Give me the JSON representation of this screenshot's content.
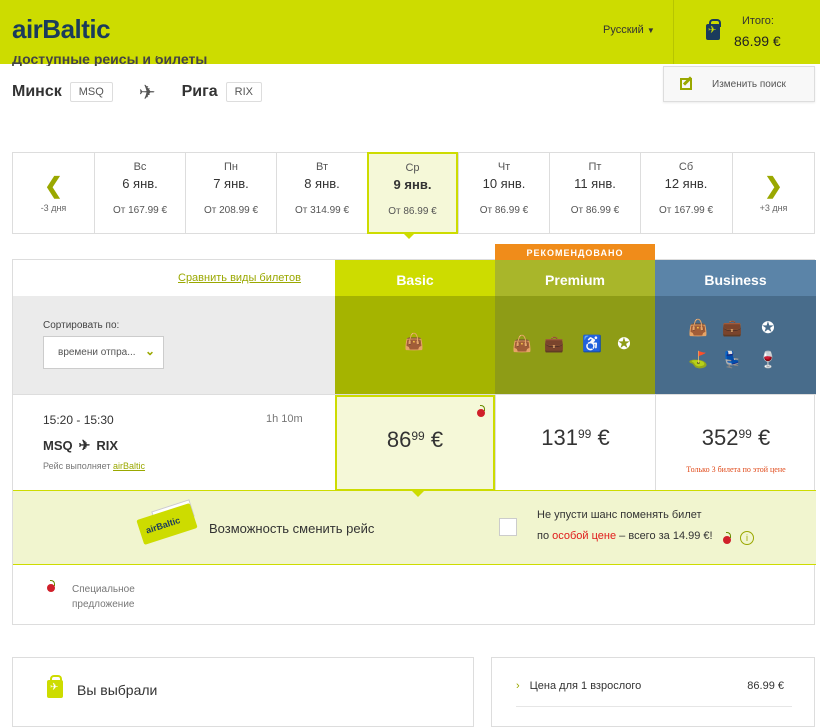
{
  "header": {
    "logo": "airBaltic",
    "language": "Русский",
    "total_label": "Итого:",
    "total_value": "86.99 €"
  },
  "route": {
    "cut_heading": "Доступные рейсы и билеты",
    "from_city": "Минск",
    "from_code": "MSQ",
    "to_city": "Рига",
    "to_code": "RIX",
    "change_search": "Изменить поиск"
  },
  "dates": {
    "prev_label": "-3 дня",
    "next_label": "+3 дня",
    "days": [
      {
        "dow": "Вс",
        "date": "6 янв.",
        "price": "От 167.99 €"
      },
      {
        "dow": "Пн",
        "date": "7 янв.",
        "price": "От 208.99 €"
      },
      {
        "dow": "Вт",
        "date": "8 янв.",
        "price": "От 314.99 €"
      },
      {
        "dow": "Ср",
        "date": "9 янв.",
        "price": "От 86.99 €"
      },
      {
        "dow": "Чт",
        "date": "10 янв.",
        "price": "От 86.99 €"
      },
      {
        "dow": "Пт",
        "date": "11 янв.",
        "price": "От 86.99 €"
      },
      {
        "dow": "Сб",
        "date": "12 янв.",
        "price": "От 167.99 €"
      }
    ]
  },
  "fares": {
    "compare_link": "Сравнить виды билетов",
    "sort_label": "Сортировать по:",
    "sort_value": "времени отпра...",
    "recommended": "РЕКОМЕНДОВАНО",
    "classes": [
      "Basic",
      "Premium",
      "Business"
    ]
  },
  "flight": {
    "time": "15:20 - 15:30",
    "duration": "1h 10m",
    "from": "MSQ",
    "to": "RIX",
    "operated_by": "Рейс выполняет",
    "operator": "airBaltic",
    "price_basic_int": "86",
    "price_basic_dec": "99",
    "price_premium_int": "131",
    "price_premium_dec": "99",
    "price_business_int": "352",
    "price_business_dec": "99",
    "currency": "€",
    "business_note": "Только 3 билета по этой цене"
  },
  "change_offer": {
    "title": "Возможность сменить рейс",
    "text1": "Не упусти шанс поменять билет",
    "text2_pre": "по",
    "text2_red": "особой цене",
    "text2_post": "– всего за 14.99 €!",
    "ticket_brand": "airBaltic"
  },
  "legend": {
    "special": "Специальное предложение"
  },
  "summary": {
    "chosen": "Вы выбрали",
    "price_line": "Цена для 1 взрослого",
    "price_value": "86.99 €"
  }
}
